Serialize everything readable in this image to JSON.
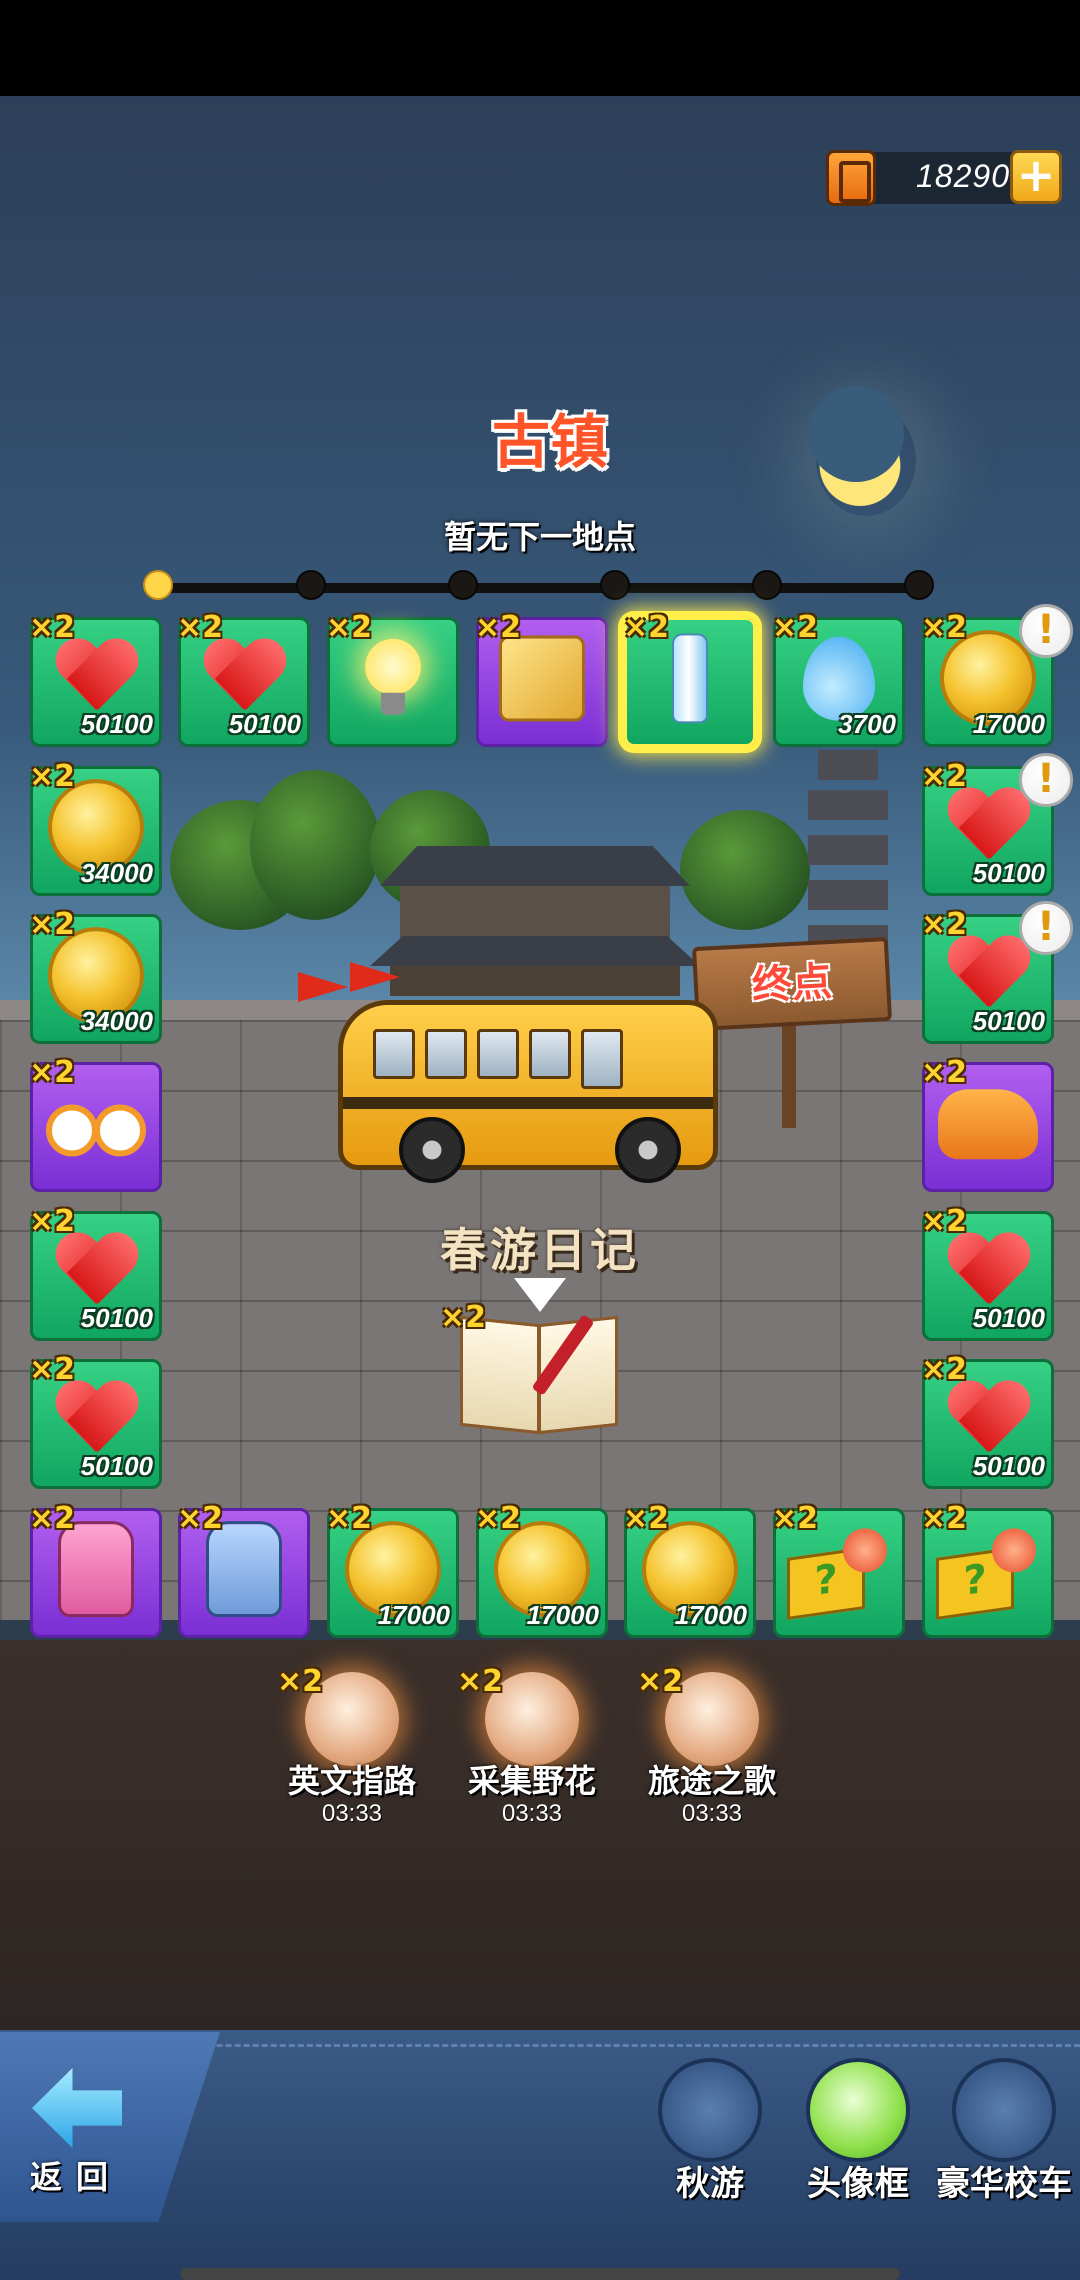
{
  "currency": {
    "fuel_amount": "18290",
    "add_symbol": "+"
  },
  "location": {
    "title": "古镇",
    "subtitle": "暂无下一地点",
    "progress_nodes": 6,
    "progress_current": 1,
    "end_sign": "终点"
  },
  "diary": {
    "label": "春游日记",
    "count": "×2"
  },
  "board": {
    "tiles": [
      {
        "item": "heart-icon",
        "count": "×2",
        "value": "50100",
        "color": "green"
      },
      {
        "item": "heart-icon",
        "count": "×2",
        "value": "50100",
        "color": "green"
      },
      {
        "item": "lightbulb-icon",
        "count": "×2",
        "value": "",
        "color": "green"
      },
      {
        "item": "scroll-icon",
        "count": "×2",
        "value": "",
        "color": "purple"
      },
      {
        "item": "water-bottle-icon",
        "count": "×2",
        "value": "",
        "color": "green",
        "selected": true
      },
      {
        "item": "water-drop-icon",
        "count": "×2",
        "value": "3700",
        "color": "green"
      },
      {
        "item": "coin-icon",
        "count": "×2",
        "value": "17000",
        "color": "green",
        "alert": "!"
      },
      {
        "item": "coin-icon",
        "count": "×2",
        "value": "34000",
        "color": "green"
      },
      {
        "item": "heart-icon",
        "count": "×2",
        "value": "50100",
        "color": "green",
        "alert": "!"
      },
      {
        "item": "coin-icon",
        "count": "×2",
        "value": "34000",
        "color": "green"
      },
      {
        "item": "heart-icon",
        "count": "×2",
        "value": "50100",
        "color": "green",
        "alert": "!"
      },
      {
        "item": "bicycle-icon",
        "count": "×2",
        "value": "",
        "color": "purple"
      },
      {
        "item": "scooter-icon",
        "count": "×2",
        "value": "",
        "color": "purple"
      },
      {
        "item": "heart-icon",
        "count": "×2",
        "value": "50100",
        "color": "green"
      },
      {
        "item": "heart-icon",
        "count": "×2",
        "value": "50100",
        "color": "green"
      },
      {
        "item": "heart-icon",
        "count": "×2",
        "value": "50100",
        "color": "green"
      },
      {
        "item": "heart-icon",
        "count": "×2",
        "value": "50100",
        "color": "green"
      },
      {
        "item": "pink-backpack-icon",
        "count": "×2",
        "value": "",
        "color": "purple"
      },
      {
        "item": "blue-backpack-icon",
        "count": "×2",
        "value": "",
        "color": "purple"
      },
      {
        "item": "coin-icon",
        "count": "×2",
        "value": "17000",
        "color": "green"
      },
      {
        "item": "coin-icon",
        "count": "×2",
        "value": "17000",
        "color": "green"
      },
      {
        "item": "coin-icon",
        "count": "×2",
        "value": "17000",
        "color": "green"
      },
      {
        "item": "mystery-box-icon",
        "count": "×2",
        "value": "",
        "color": "green"
      },
      {
        "item": "mystery-box-icon",
        "count": "×2",
        "value": "",
        "color": "green"
      }
    ]
  },
  "quests": [
    {
      "name": "英文指路",
      "time": "03:33",
      "count": "×2",
      "icon": "tourist-question-icon"
    },
    {
      "name": "采集野花",
      "time": "03:33",
      "count": "×2",
      "icon": "flower-bouquet-icon"
    },
    {
      "name": "旅途之歌",
      "time": "03:33",
      "count": "×2",
      "icon": "microphone-star-icon"
    }
  ],
  "bottom_nav": {
    "back_label": "返回",
    "items": [
      {
        "label": "秋游",
        "icon": "kids-trip-icon"
      },
      {
        "label": "头像框",
        "icon": "avatar-frame-icon"
      },
      {
        "label": "豪华校车",
        "icon": "school-bus-icon"
      }
    ]
  },
  "colors": {
    "tile_green": "#1fba6e",
    "tile_purple": "#9544e2",
    "title_red": "#ff5428",
    "coin_gold": "#f5c431",
    "bottom_bar": "#2f4d78"
  }
}
